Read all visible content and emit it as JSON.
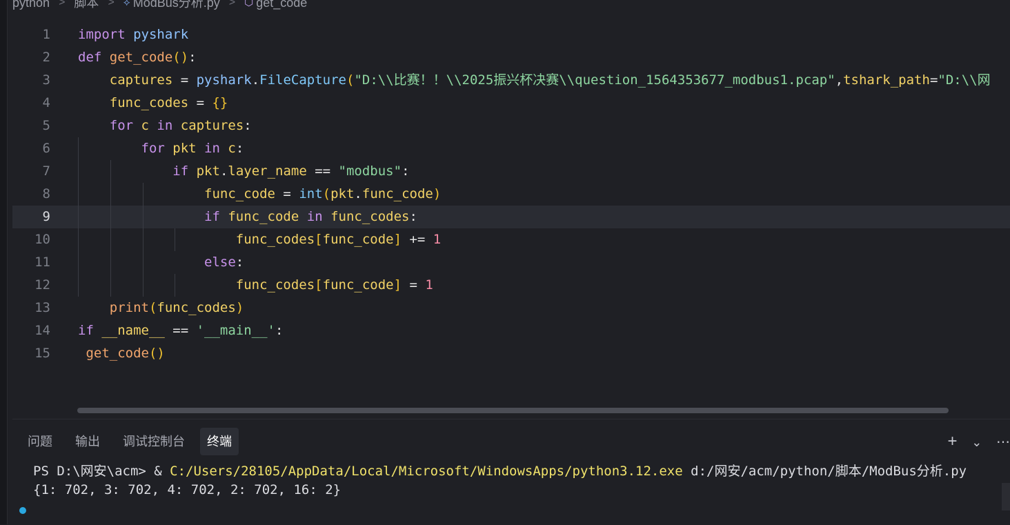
{
  "breadcrumb": {
    "items": [
      "python",
      "脚本",
      "ModBus分析.py",
      "get_code"
    ],
    "separator": ">"
  },
  "editor": {
    "current_line": 9,
    "lines": [
      {
        "n": "1",
        "t": [
          [
            "kw",
            "import "
          ],
          [
            "mod",
            "pyshark"
          ]
        ]
      },
      {
        "n": "2",
        "t": [
          [
            "kw",
            "def "
          ],
          [
            "fn",
            "get_code"
          ],
          [
            "par",
            "()"
          ],
          [
            "plain",
            ":"
          ]
        ]
      },
      {
        "n": "3",
        "t": [
          [
            "plain",
            "    "
          ],
          [
            "var",
            "captures"
          ],
          [
            "plain",
            " = "
          ],
          [
            "mod",
            "pyshark"
          ],
          [
            "plain",
            "."
          ],
          [
            "bi",
            "FileCapture"
          ],
          [
            "par",
            "("
          ],
          [
            "str",
            "\"D:\\\\比赛！！\\\\2025振兴杯决赛\\\\question_1564353677_modbus1.pcap\""
          ],
          [
            "plain",
            ","
          ],
          [
            "var",
            "tshark_path"
          ],
          [
            "plain",
            "="
          ],
          [
            "str",
            "\"D:\\\\网"
          ]
        ]
      },
      {
        "n": "4",
        "t": [
          [
            "plain",
            "    "
          ],
          [
            "var",
            "func_codes"
          ],
          [
            "plain",
            " = "
          ],
          [
            "par",
            "{}"
          ]
        ]
      },
      {
        "n": "5",
        "t": [
          [
            "plain",
            "    "
          ],
          [
            "kw",
            "for "
          ],
          [
            "var",
            "c"
          ],
          [
            "kw",
            " in "
          ],
          [
            "var",
            "captures"
          ],
          [
            "plain",
            ":"
          ]
        ]
      },
      {
        "n": "6",
        "t": [
          [
            "plain",
            "        "
          ],
          [
            "kw",
            "for "
          ],
          [
            "var",
            "pkt"
          ],
          [
            "kw",
            " in "
          ],
          [
            "var",
            "c"
          ],
          [
            "plain",
            ":"
          ]
        ]
      },
      {
        "n": "7",
        "t": [
          [
            "plain",
            "            "
          ],
          [
            "kw",
            "if "
          ],
          [
            "var",
            "pkt"
          ],
          [
            "plain",
            "."
          ],
          [
            "var",
            "layer_name"
          ],
          [
            "plain",
            " == "
          ],
          [
            "str",
            "\"modbus\""
          ],
          [
            "plain",
            ":"
          ]
        ]
      },
      {
        "n": "8",
        "t": [
          [
            "plain",
            "                "
          ],
          [
            "var",
            "func_code"
          ],
          [
            "plain",
            " = "
          ],
          [
            "bi",
            "int"
          ],
          [
            "par",
            "("
          ],
          [
            "var",
            "pkt"
          ],
          [
            "plain",
            "."
          ],
          [
            "var",
            "func_code"
          ],
          [
            "par",
            ")"
          ]
        ]
      },
      {
        "n": "9",
        "t": [
          [
            "plain",
            "                "
          ],
          [
            "kw",
            "if "
          ],
          [
            "var",
            "func_code"
          ],
          [
            "kw",
            " in "
          ],
          [
            "var",
            "func_codes"
          ],
          [
            "plain",
            ":"
          ]
        ]
      },
      {
        "n": "10",
        "t": [
          [
            "plain",
            "                    "
          ],
          [
            "var",
            "func_codes"
          ],
          [
            "par",
            "["
          ],
          [
            "var",
            "func_code"
          ],
          [
            "par",
            "]"
          ],
          [
            "plain",
            " += "
          ],
          [
            "num",
            "1"
          ]
        ]
      },
      {
        "n": "11",
        "t": [
          [
            "plain",
            "                "
          ],
          [
            "kw",
            "else"
          ],
          [
            "plain",
            ":"
          ]
        ]
      },
      {
        "n": "12",
        "t": [
          [
            "plain",
            "                    "
          ],
          [
            "var",
            "func_codes"
          ],
          [
            "par",
            "["
          ],
          [
            "var",
            "func_code"
          ],
          [
            "par",
            "]"
          ],
          [
            "plain",
            " = "
          ],
          [
            "num",
            "1"
          ]
        ]
      },
      {
        "n": "13",
        "t": [
          [
            "plain",
            "    "
          ],
          [
            "fn",
            "print"
          ],
          [
            "par",
            "("
          ],
          [
            "var",
            "func_codes"
          ],
          [
            "par",
            ")"
          ]
        ]
      },
      {
        "n": "14",
        "t": [
          [
            "kw",
            "if "
          ],
          [
            "var",
            "__name__"
          ],
          [
            "plain",
            " == "
          ],
          [
            "str",
            "'__main__'"
          ],
          [
            "plain",
            ":"
          ]
        ]
      },
      {
        "n": "15",
        "t": [
          [
            "plain",
            " "
          ],
          [
            "fn",
            "get_code"
          ],
          [
            "par",
            "()"
          ]
        ]
      }
    ]
  },
  "panel": {
    "tabs": [
      "问题",
      "输出",
      "调试控制台",
      "终端"
    ],
    "active_tab": "终端",
    "actions": {
      "add": "+",
      "dropdown": "⌄",
      "more": "⋯"
    }
  },
  "terminal": {
    "prompt": "PS D:\\网安\\acm> & ",
    "exe": "C:/Users/28105/AppData/Local/Microsoft/WindowsApps/python3.12.exe",
    "script": " d:/网安/acm/python/脚本/ModBus分析.py",
    "output": "{1: 702, 3: 702, 4: 702, 2: 702, 16: 2}"
  }
}
